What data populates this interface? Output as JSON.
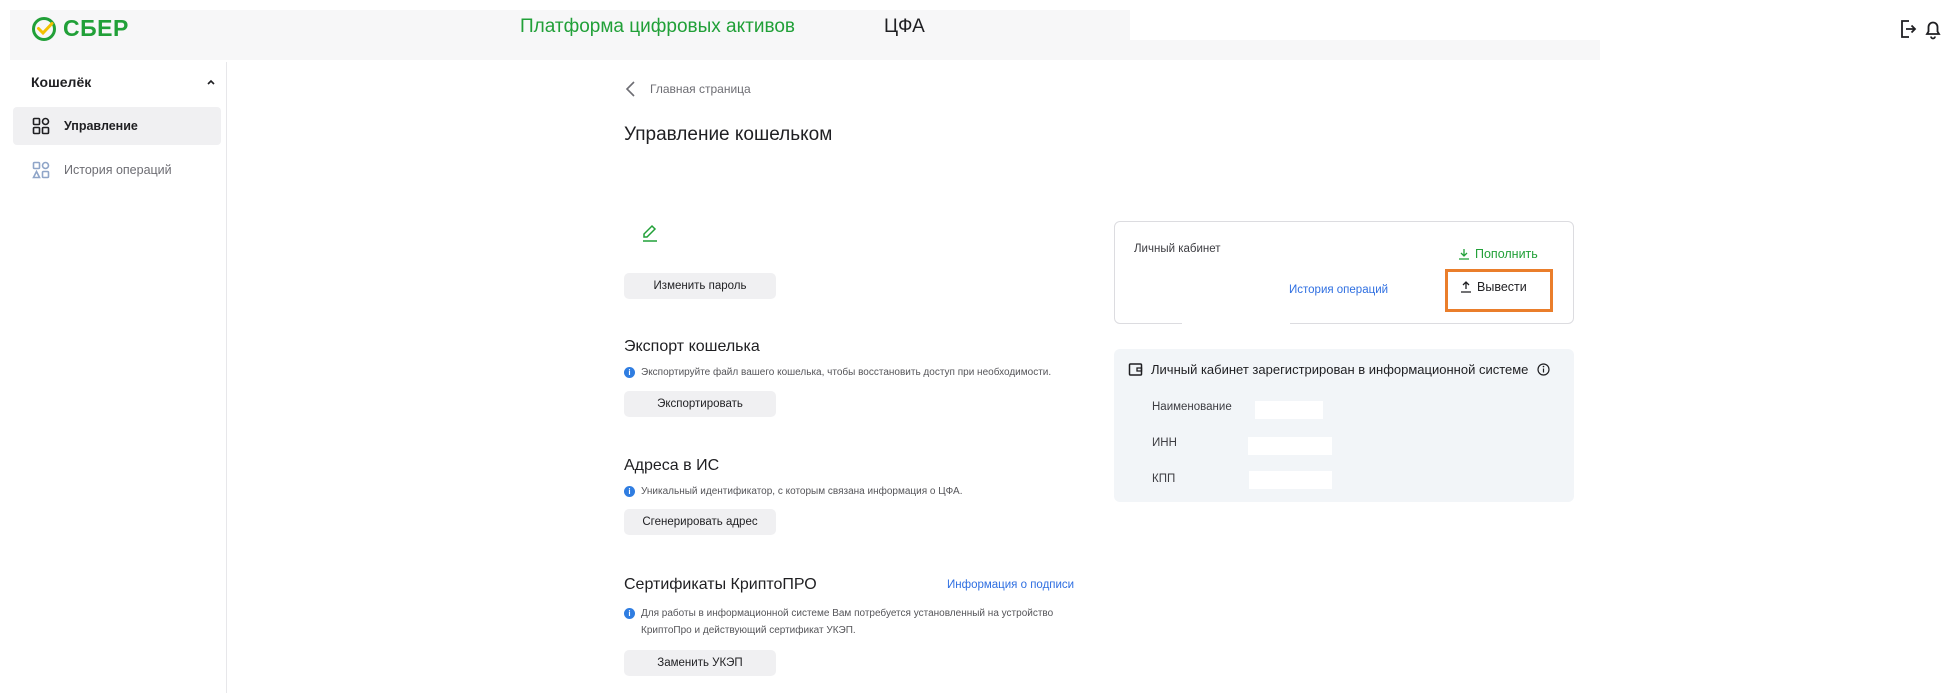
{
  "header": {
    "logo_text": "СБЕР",
    "platform_title": "Платформа цифровых активов",
    "cfa_label": "ЦФА",
    "icons": [
      "logout-icon",
      "bell-icon"
    ],
    "brand_color": "#21a038"
  },
  "sidebar": {
    "group_title": "Кошелёк",
    "items": [
      {
        "label": "Управление",
        "active": true,
        "icon": "grid-icon"
      },
      {
        "label": "История операций",
        "active": false,
        "icon": "grid-icon"
      }
    ]
  },
  "main": {
    "breadcrumb": "Главная страница",
    "page_title": "Управление кошельком",
    "change_password_button": "Изменить пароль",
    "export": {
      "title": "Экспорт кошелька",
      "info": "Экспортируйте файл вашего кошелька, чтобы восстановить доступ при необходимости.",
      "button": "Экспортировать"
    },
    "addresses": {
      "title": "Адреса в ИС",
      "info": "Уникальный идентификатор, с которым связана информация о ЦФА.",
      "button": "Сгенерировать адрес"
    },
    "certificates": {
      "title": "Сертификаты КриптоПРО",
      "link": "Информация о подписи",
      "info_line1": "Для работы в информационной системе Вам потребуется установленный на устройство",
      "info_line2": "КриптоПро и действующий сертификат УКЭП.",
      "button": "Заменить УКЭП"
    }
  },
  "account_card": {
    "label": "Личный кабинет",
    "topup_label": "Пополнить",
    "history_link": "История операций",
    "withdraw_label": "Вывести",
    "highlight_color": "#ea7e2b"
  },
  "registration_card": {
    "title": "Личный кабинет зарегистрирован в информационной системе",
    "fields": [
      {
        "label": "Наименование",
        "value": ""
      },
      {
        "label": "ИНН",
        "value": ""
      },
      {
        "label": "КПП",
        "value": ""
      }
    ]
  }
}
